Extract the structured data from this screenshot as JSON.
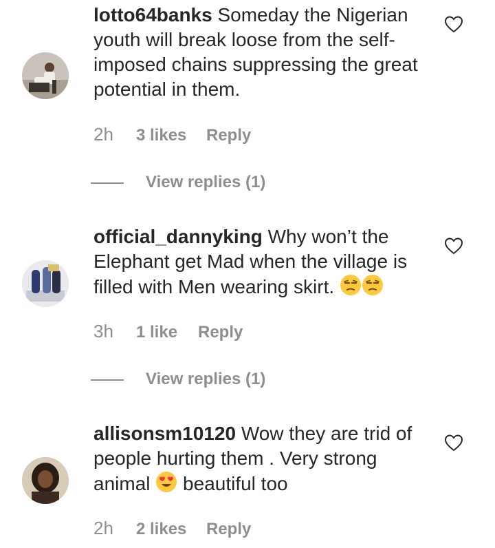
{
  "comments": [
    {
      "username": "lotto64banks",
      "text": "Someday the Nigerian youth will break loose from the self-imposed chains suppressing the great potential in them.",
      "time": "2h",
      "likes": "3 likes",
      "reply": "Reply",
      "view_replies": "View replies (1)",
      "avatar_icon": "avatar-photo-man-seated"
    },
    {
      "username": "official_dannyking",
      "text": "Why won’t the Elephant get Mad when the village is filled with Men wearing skirt. ",
      "emojis": [
        "unamused-face-emoji",
        "unamused-face-emoji"
      ],
      "time": "3h",
      "likes": "1 like",
      "reply": "Reply",
      "view_replies": "View replies (1)",
      "avatar_icon": "avatar-photo-figures"
    },
    {
      "username": "allisonsm10120",
      "text_before_emoji": "Wow they are trid of people hurting them . Very strong animal ",
      "emoji": "heart-eyes-emoji",
      "text_after_emoji": " beautiful too",
      "time": "2h",
      "likes": "2 likes",
      "reply": "Reply",
      "avatar_icon": "avatar-photo-woman"
    }
  ],
  "colors": {
    "text": "#262626",
    "muted": "#8e8e8e",
    "background": "#ffffff"
  }
}
